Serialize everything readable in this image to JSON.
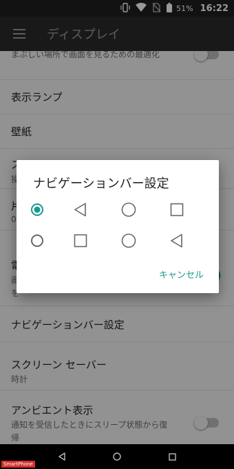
{
  "status_bar": {
    "battery_percent": "51%",
    "time": "16:22"
  },
  "app_bar": {
    "title": "ディスプレイ"
  },
  "settings": [
    {
      "title": "",
      "summary": "まぶしい場所で画面を見るための最適化",
      "toggle": false
    },
    {
      "title": "表示ランプ"
    },
    {
      "title": "壁紙"
    },
    {
      "title": "ス",
      "summary": "操"
    },
    {
      "title": "片",
      "summary": "0"
    },
    {
      "title": "電",
      "summary": "画",
      "summary2": "を",
      "toggle": true
    },
    {
      "title": "ナビゲーションバー設定"
    },
    {
      "title": "スクリーン セーバー",
      "summary": "時計"
    },
    {
      "title": "アンビエント表示",
      "summary": "通知を受信したときにスリープ状態から復",
      "summary2": "帰",
      "toggle": false
    }
  ],
  "dialog": {
    "title": "ナビゲーションバー設定",
    "options": [
      {
        "selected": true,
        "icons": [
          "back-icon",
          "home-icon",
          "recents-icon"
        ]
      },
      {
        "selected": false,
        "icons": [
          "recents-icon",
          "home-icon",
          "back-icon"
        ]
      }
    ],
    "cancel_label": "キャンセル"
  },
  "colors": {
    "accent": "#159a8f",
    "app_bar": "#2b2b2b",
    "status_bar": "#1f1f1f"
  },
  "watermark": "SmartPhone"
}
